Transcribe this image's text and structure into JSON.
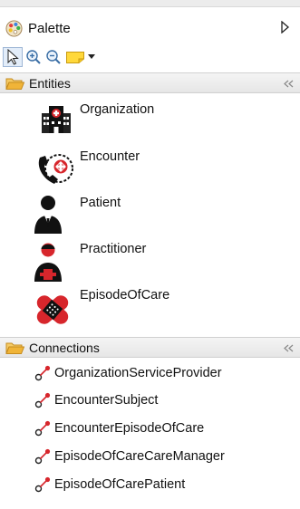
{
  "palette": {
    "title": "Palette"
  },
  "toolbar": {
    "tools": [
      "select-tool",
      "zoom-in-tool",
      "zoom-out-tool",
      "note-tool",
      "dropdown"
    ]
  },
  "entities": {
    "label": "Entities",
    "items": [
      {
        "label": "Organization",
        "icon": "organization-icon"
      },
      {
        "label": "Encounter",
        "icon": "encounter-icon"
      },
      {
        "label": "Patient",
        "icon": "patient-icon"
      },
      {
        "label": "Practitioner",
        "icon": "practitioner-icon"
      },
      {
        "label": "EpisodeOfCare",
        "icon": "episode-of-care-icon"
      }
    ]
  },
  "connections": {
    "label": "Connections",
    "items": [
      {
        "label": "OrganizationServiceProvider"
      },
      {
        "label": "EncounterSubject"
      },
      {
        "label": "EncounterEpisodeOfCare"
      },
      {
        "label": "EpisodeOfCareCareManager"
      },
      {
        "label": "EpisodeOfCarePatient"
      }
    ]
  },
  "colors": {
    "accent_red": "#d7262c",
    "folder": "#f0b438",
    "selection": "#e3edf9",
    "note_yellow": "#ffd83a"
  }
}
